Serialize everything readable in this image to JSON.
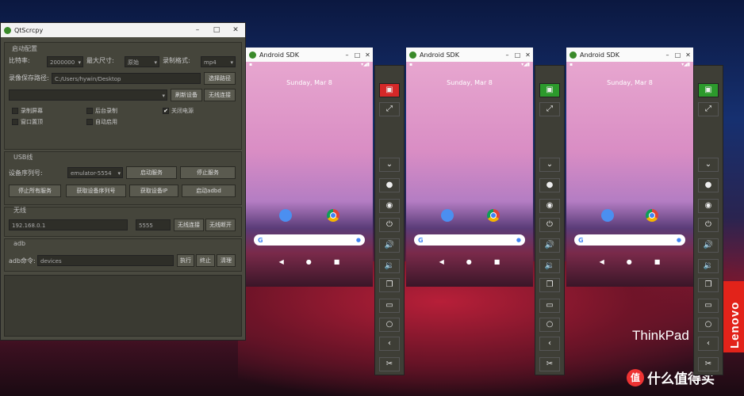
{
  "desktop": {
    "brand_vertical": "Lenovo",
    "brand_thinkpad": "ThinkPad",
    "watermark_logo": "值",
    "watermark_text": "什么值得买",
    "colors": {
      "lenovo_red": "#e2231a",
      "qt_bg": "#4a4a40"
    }
  },
  "qt": {
    "title": "QtScrcpy",
    "controls": [
      "–",
      "□",
      "✕"
    ],
    "config_group": "启动配置",
    "bitrate_label": "比特率:",
    "bitrate_value": "2000000",
    "maxsize_label": "最大尺寸:",
    "maxsize_value": "原始",
    "record_format_label": "录制格式:",
    "record_format_value": "mp4",
    "record_path_label": "录像保存路径:",
    "record_path_value": "C:/Users/hywin/Desktop",
    "select_path_button": "选择路径",
    "serial_field": "",
    "refresh_button": "刷新设备",
    "wireless_button": "无线连接",
    "checkboxes": [
      {
        "label": "录制屏幕",
        "checked": false
      },
      {
        "label": "后台录制",
        "checked": false
      },
      {
        "label": "关闭电源",
        "checked": true
      },
      {
        "label": "窗口置顶",
        "checked": false
      },
      {
        "label": "自动启用",
        "checked": false
      }
    ],
    "usb_group": "USB线",
    "device_serial_label": "设备序列号:",
    "device_serial_value": "emulator-5554",
    "start_service_button": "启动服务",
    "stop_service_button": "停止服务",
    "stop_all_button": "停止所有服务",
    "get_ip_button": "获取设备IP",
    "get_serial_button": "获取设备序列号",
    "start_adbd_button": "启动adbd",
    "wireless_group": "无线",
    "ip_placeholder": "192.168.0.1",
    "port_value": "5555",
    "wireless_connect_button": "无线连接",
    "wireless_disconnect_button": "无线断开",
    "adb_group": "adb",
    "adb_cmd_label": "adb命令:",
    "adb_cmd_value": "devices",
    "execute_button": "执行",
    "terminate_button": "终止",
    "clear_button": "清理"
  },
  "phones": [
    {
      "title": "Android SDK",
      "date": "Sunday, Mar 8",
      "toolbar_top_color": "#d52828"
    },
    {
      "title": "Android SDK",
      "date": "Sunday, Mar 8",
      "toolbar_top_color": "#2c9a2c"
    },
    {
      "title": "Android SDK",
      "date": "Sunday, Mar 8",
      "toolbar_top_color": "#2c9a2c"
    }
  ],
  "toolbar_icons": [
    "full-screen-icon",
    "fullscreen-icon",
    "collapse-icon",
    "home-icon",
    "visibility-icon",
    "power-icon",
    "volume-up-icon",
    "volume-down-icon",
    "app-switch-icon",
    "menu-icon",
    "home-circle-icon",
    "back-icon",
    "screenshot-icon"
  ]
}
